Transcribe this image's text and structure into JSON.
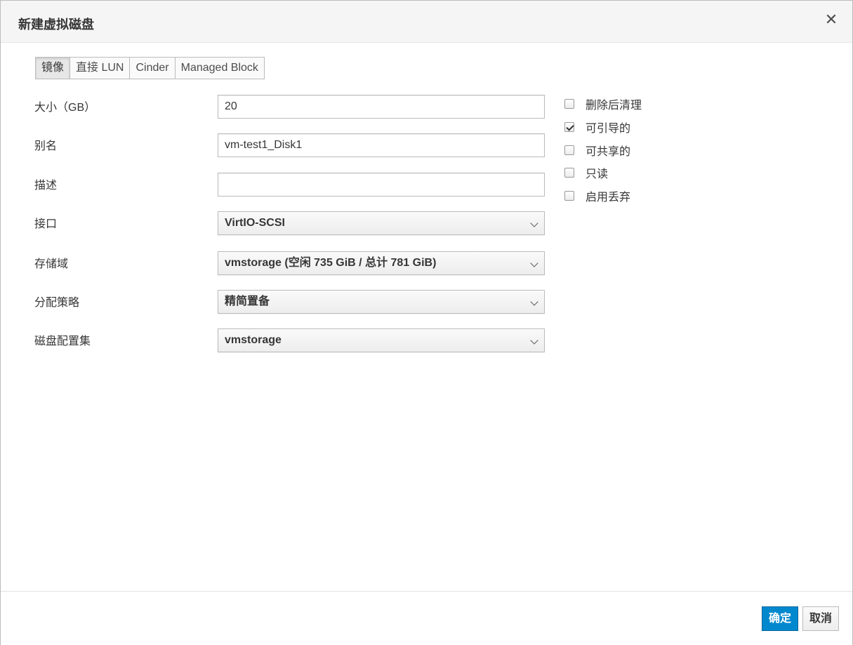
{
  "dialog": {
    "title": "新建虚拟磁盘",
    "close_symbol": "✕"
  },
  "tabs": [
    {
      "label": "镜像",
      "active": true
    },
    {
      "label": "直接 LUN",
      "active": false
    },
    {
      "label": "Cinder",
      "active": false
    },
    {
      "label": "Managed Block",
      "active": false
    }
  ],
  "form": {
    "size": {
      "label": "大小（GB）",
      "value": "20"
    },
    "alias": {
      "label": "别名",
      "value": "vm-test1_Disk1"
    },
    "description": {
      "label": "描述",
      "value": ""
    },
    "interface": {
      "label": "接口",
      "value": "VirtIO-SCSI"
    },
    "storage_domain": {
      "label": "存储域",
      "value": "vmstorage (空闲 735 GiB / 总计 781 GiB)"
    },
    "allocation_policy": {
      "label": "分配策略",
      "value": "精简置备"
    },
    "disk_profile": {
      "label": "磁盘配置集",
      "value": "vmstorage"
    }
  },
  "options": [
    {
      "label": "删除后清理",
      "checked": false
    },
    {
      "label": "可引导的",
      "checked": true
    },
    {
      "label": "可共享的",
      "checked": false
    },
    {
      "label": "只读",
      "checked": false
    },
    {
      "label": "启用丢弃",
      "checked": false
    }
  ],
  "footer": {
    "ok_label": "确定",
    "cancel_label": "取消"
  },
  "colors": {
    "primary": "#0088ce",
    "header_bg": "#f5f5f5",
    "border": "#bbbbbb"
  }
}
